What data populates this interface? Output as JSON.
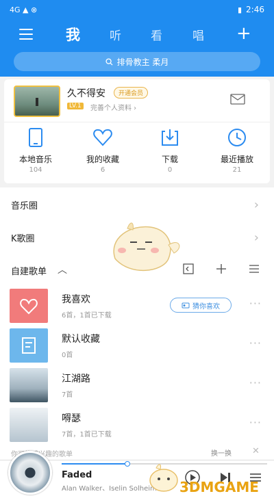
{
  "statusbar": {
    "left": "4G ▲ ⊗",
    "time": "2:46"
  },
  "header": {
    "tabs": [
      "我",
      "听",
      "看",
      "唱"
    ],
    "search_placeholder": "排骨教主 柔月"
  },
  "profile": {
    "name": "久不得安",
    "vip": "开通会员",
    "level": "LV.1",
    "link": "完善个人资料 ›"
  },
  "stats": [
    {
      "label": "本地音乐",
      "count": "104"
    },
    {
      "label": "我的收藏",
      "count": "6"
    },
    {
      "label": "下载",
      "count": "0"
    },
    {
      "label": "最近播放",
      "count": "21"
    }
  ],
  "rows": {
    "music_circle": "音乐圈",
    "k_song": "K歌圈"
  },
  "playlists": {
    "header": "自建歌单",
    "items": [
      {
        "title": "我喜欢",
        "sub": "6首，1首已下载",
        "button": "猜你喜欢"
      },
      {
        "title": "默认收藏",
        "sub": "0首"
      },
      {
        "title": "江湖路",
        "sub": "7首"
      },
      {
        "title": "嘚瑟",
        "sub": "7首，1首已下载"
      }
    ]
  },
  "suggest": {
    "text": "你可能感兴趣的歌单",
    "refresh": "换一换"
  },
  "player": {
    "title": "Faded",
    "artist": "Alan Walker、Iselin Solheim",
    "progress": 0.32
  },
  "watermark": "3DMGAME",
  "colors": {
    "accent": "#1f8cf0",
    "heart_bg": "#f17b7b",
    "default_bg": "#6db7ec"
  }
}
